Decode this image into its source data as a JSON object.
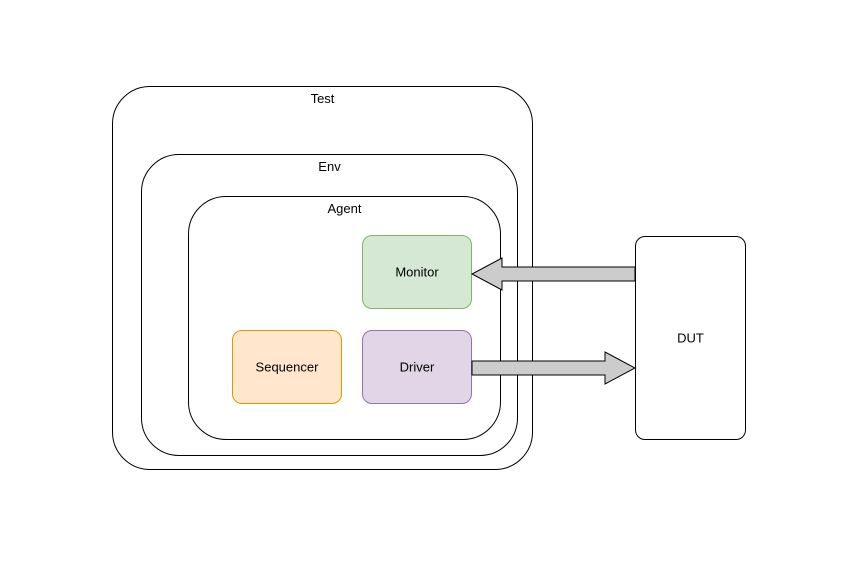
{
  "diagram": {
    "test": {
      "label": "Test"
    },
    "env": {
      "label": "Env"
    },
    "agent": {
      "label": "Agent"
    },
    "monitor": {
      "label": "Monitor",
      "fill": "#d5e8d4",
      "stroke": "#82b366"
    },
    "sequencer": {
      "label": "Sequencer",
      "fill": "#ffe6cc",
      "stroke": "#d79b00"
    },
    "driver": {
      "label": "Driver",
      "fill": "#e1d5e7",
      "stroke": "#9673a6"
    },
    "dut": {
      "label": "DUT"
    },
    "arrow": {
      "fill": "#cccccc",
      "stroke": "#000000"
    }
  }
}
